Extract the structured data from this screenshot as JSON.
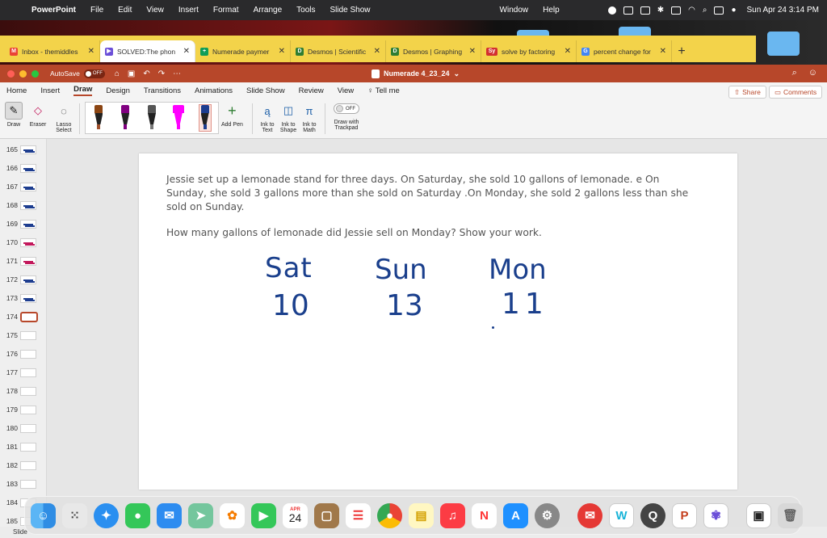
{
  "menubar": {
    "app_name": "PowerPoint",
    "items": [
      "File",
      "Edit",
      "View",
      "Insert",
      "Format",
      "Arrange",
      "Tools",
      "Slide Show",
      "Window",
      "Help"
    ],
    "datetime": "Sun Apr 24  3:14 PM"
  },
  "browser": {
    "tabs": [
      {
        "label": "Inbox - themiddles",
        "fav_color": "#ea4335",
        "fav_glyph": "M"
      },
      {
        "label": "SOLVED:The phon",
        "fav_color": "#6b4fd8",
        "fav_glyph": "▶"
      },
      {
        "label": "Numerade paymer",
        "fav_color": "#0f9d58",
        "fav_glyph": "+"
      },
      {
        "label": "Desmos | Scientific",
        "fav_color": "#2e7d32",
        "fav_glyph": "D"
      },
      {
        "label": "Desmos | Graphing",
        "fav_color": "#2e7d32",
        "fav_glyph": "D"
      },
      {
        "label": "solve by factoring",
        "fav_color": "#d32f2f",
        "fav_glyph": "Sy"
      },
      {
        "label": "percent change for",
        "fav_color": "#4285f4",
        "fav_glyph": "G"
      }
    ],
    "new_tab": "+"
  },
  "powerpoint": {
    "autosave_label": "AutoSave",
    "autosave_state": "OFF",
    "doc_title": "Numerade 4_23_24",
    "ribbon_tabs": [
      "Home",
      "Insert",
      "Draw",
      "Design",
      "Transitions",
      "Animations",
      "Slide Show",
      "Review",
      "View",
      "Tell me"
    ],
    "active_tab": "Draw",
    "share_label": "Share",
    "comments_label": "Comments",
    "tools": {
      "draw": "Draw",
      "eraser": "Eraser",
      "lasso": "Lasso Select",
      "add_pen": "Add Pen",
      "ink_to_text": "Ink to Text",
      "ink_to_shape": "Ink to Shape",
      "ink_to_math": "Ink to Math",
      "trackpad_toggle": "OFF",
      "draw_with_trackpad": "Draw with Trackpad"
    },
    "pens": [
      {
        "cap": "#8b4513",
        "tip": "#a0522d"
      },
      {
        "cap": "#800080",
        "tip": "#800080"
      },
      {
        "cap": "#555555",
        "tip": "#777777"
      },
      {
        "cap": "#ff00ff",
        "tip": "#ff00ff"
      },
      {
        "cap": "#1d3d8f",
        "tip": "#1d3d8f"
      }
    ],
    "slide_numbers": [
      "165",
      "166",
      "167",
      "168",
      "169",
      "170",
      "171",
      "172",
      "173",
      "174",
      "175",
      "176",
      "177",
      "178",
      "179",
      "180",
      "181",
      "182",
      "183",
      "184",
      "185"
    ],
    "selected_slide": "174",
    "status_text": "Slide"
  },
  "slide": {
    "problem": "Jessie set up a lemonade stand for three days. On Saturday, she sold 10 gallons of lemonade. e On Sunday, she sold 3 gallons more than she sold on Saturday .On Monday, she sold 2 gallons less than she sold on Sunday.",
    "question": "How many gallons of lemonade did Jessie sell on Monday? Show your work.",
    "handwriting": {
      "sat_label": "Sat",
      "sat_value": "10",
      "sun_label": "Sun",
      "sun_value": "13",
      "mon_label": "Mon",
      "mon_value": "11",
      "ink_color": "#1a3f8c"
    }
  },
  "dock": {
    "calendar_month": "APR",
    "calendar_day": "24",
    "apps": [
      "finder-icon",
      "launchpad-icon",
      "safari-icon",
      "messages-icon",
      "mail-icon",
      "maps-icon",
      "photos-icon",
      "facetime-icon",
      "calendar-icon",
      "notes-brown-icon",
      "reminders-icon",
      "chrome-icon",
      "notes-icon",
      "music-icon",
      "news-icon",
      "app-store-icon",
      "system-preferences-icon",
      "mail-red-icon",
      "w-app-icon",
      "quicktime-icon",
      "powerpoint-icon",
      "bubble-app-icon",
      "preview-icon",
      "trash-icon"
    ]
  }
}
